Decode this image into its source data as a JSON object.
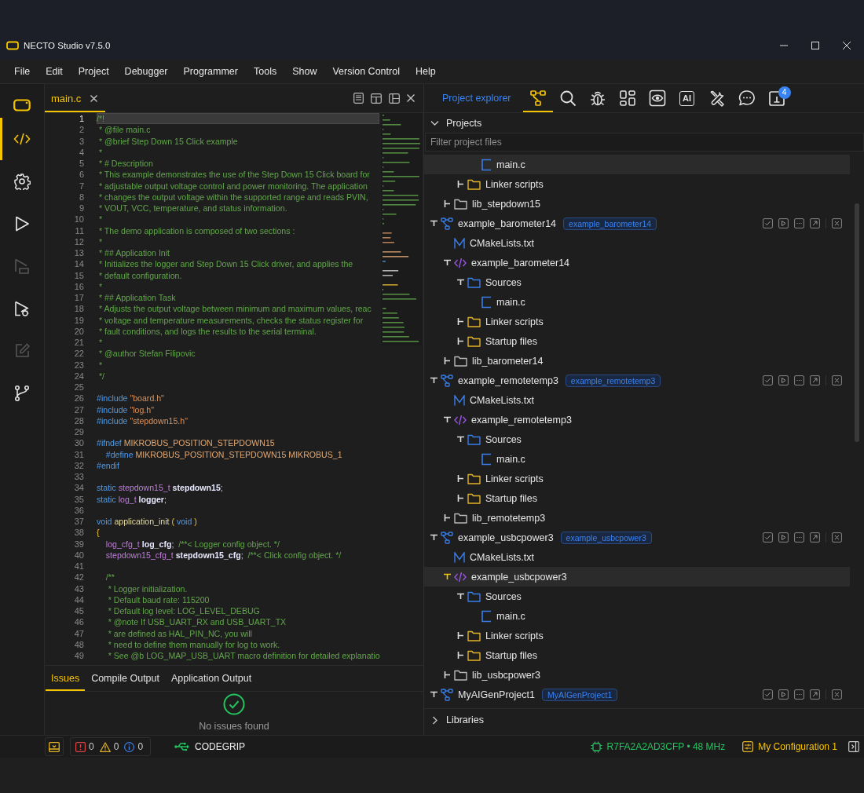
{
  "window": {
    "title": "NECTO Studio v7.5.0"
  },
  "menu": [
    {
      "label": "File"
    },
    {
      "label": "Edit"
    },
    {
      "label": "Project"
    },
    {
      "label": "Debugger"
    },
    {
      "label": "Programmer"
    },
    {
      "label": "Tools"
    },
    {
      "label": "Show"
    },
    {
      "label": "Version Control"
    },
    {
      "label": "Help"
    }
  ],
  "activity": [
    {
      "kind": "code",
      "selected": true,
      "disabled": false
    },
    {
      "kind": "settings",
      "selected": false,
      "disabled": false
    },
    {
      "kind": "run",
      "selected": false,
      "disabled": false
    },
    {
      "kind": "program",
      "selected": false,
      "disabled": true
    },
    {
      "kind": "debug",
      "selected": false,
      "disabled": false
    },
    {
      "kind": "edit",
      "selected": false,
      "disabled": true
    },
    {
      "kind": "branch",
      "selected": false,
      "disabled": false
    }
  ],
  "editor": {
    "tabs": [
      {
        "label": "main.c",
        "selected": true
      }
    ],
    "lines": [
      {
        "number": "1",
        "current": true,
        "tokens": [
          {
            "kind": "comment",
            "text": "/*!"
          }
        ]
      },
      {
        "number": "2",
        "current": false,
        "tokens": [
          {
            "kind": "comment",
            "text": " * @file main.c"
          }
        ]
      },
      {
        "number": "3",
        "current": false,
        "tokens": [
          {
            "kind": "comment",
            "text": " * @brief Step Down 15 Click example"
          }
        ]
      },
      {
        "number": "4",
        "current": false,
        "tokens": [
          {
            "kind": "comment",
            "text": " *"
          }
        ]
      },
      {
        "number": "5",
        "current": false,
        "tokens": [
          {
            "kind": "comment",
            "text": " * # Description"
          }
        ]
      },
      {
        "number": "6",
        "current": false,
        "tokens": [
          {
            "kind": "comment",
            "text": " * This example demonstrates the use of the Step Down 15 Click board for"
          }
        ]
      },
      {
        "number": "7",
        "current": false,
        "tokens": [
          {
            "kind": "comment",
            "text": " * adjustable output voltage control and power monitoring. The application"
          }
        ]
      },
      {
        "number": "8",
        "current": false,
        "tokens": [
          {
            "kind": "comment",
            "text": " * changes the output voltage within the supported range and reads PVIN,"
          }
        ]
      },
      {
        "number": "9",
        "current": false,
        "tokens": [
          {
            "kind": "comment",
            "text": " * VOUT, VCC, temperature, and status information."
          }
        ]
      },
      {
        "number": "10",
        "current": false,
        "tokens": [
          {
            "kind": "comment",
            "text": " *"
          }
        ]
      },
      {
        "number": "11",
        "current": false,
        "tokens": [
          {
            "kind": "comment",
            "text": " * The demo application is composed of two sections :"
          }
        ]
      },
      {
        "number": "12",
        "current": false,
        "tokens": [
          {
            "kind": "comment",
            "text": " *"
          }
        ]
      },
      {
        "number": "13",
        "current": false,
        "tokens": [
          {
            "kind": "comment",
            "text": " * ## Application Init"
          }
        ]
      },
      {
        "number": "14",
        "current": false,
        "tokens": [
          {
            "kind": "comment",
            "text": " * Initializes the logger and Step Down 15 Click driver, and applies the"
          }
        ]
      },
      {
        "number": "15",
        "current": false,
        "tokens": [
          {
            "kind": "comment",
            "text": " * default configuration."
          }
        ]
      },
      {
        "number": "16",
        "current": false,
        "tokens": [
          {
            "kind": "comment",
            "text": " *"
          }
        ]
      },
      {
        "number": "17",
        "current": false,
        "tokens": [
          {
            "kind": "comment",
            "text": " * ## Application Task"
          }
        ]
      },
      {
        "number": "18",
        "current": false,
        "tokens": [
          {
            "kind": "comment",
            "text": " * Adjusts the output voltage between minimum and maximum values, reac"
          }
        ]
      },
      {
        "number": "19",
        "current": false,
        "tokens": [
          {
            "kind": "comment",
            "text": " * voltage and temperature measurements, checks the status register for"
          }
        ]
      },
      {
        "number": "20",
        "current": false,
        "tokens": [
          {
            "kind": "comment",
            "text": " * fault conditions, and logs the results to the serial terminal."
          }
        ]
      },
      {
        "number": "21",
        "current": false,
        "tokens": [
          {
            "kind": "comment",
            "text": " *"
          }
        ]
      },
      {
        "number": "22",
        "current": false,
        "tokens": [
          {
            "kind": "comment",
            "text": " * @author Stefan Filipovic"
          }
        ]
      },
      {
        "number": "23",
        "current": false,
        "tokens": [
          {
            "kind": "comment",
            "text": " *"
          }
        ]
      },
      {
        "number": "24",
        "current": false,
        "tokens": [
          {
            "kind": "comment",
            "text": " */"
          }
        ]
      },
      {
        "number": "25",
        "current": false
      },
      {
        "number": "26",
        "current": false,
        "tokens": [
          {
            "kind": "keyword",
            "text": "#include"
          },
          {
            "kind": "string",
            "text": " \"board.h\""
          }
        ]
      },
      {
        "number": "27",
        "current": false,
        "tokens": [
          {
            "kind": "keyword",
            "text": "#include"
          },
          {
            "kind": "string",
            "text": " \"log.h\""
          }
        ]
      },
      {
        "number": "28",
        "current": false,
        "tokens": [
          {
            "kind": "keyword",
            "text": "#include"
          },
          {
            "kind": "string",
            "text": " \"stepdown15.h\""
          }
        ]
      },
      {
        "number": "29",
        "current": false
      },
      {
        "number": "30",
        "current": false,
        "tokens": [
          {
            "kind": "keyword",
            "text": "#ifndef"
          },
          {
            "kind": "macro",
            "text": " MIKROBUS_POSITION_STEPDOWN15"
          }
        ]
      },
      {
        "number": "31",
        "current": false,
        "tokens": [
          {
            "kind": "keyword",
            "text": "    #define"
          },
          {
            "kind": "macro",
            "text": " MIKROBUS_POSITION_STEPDOWN15 MIKROBUS_1"
          }
        ]
      },
      {
        "number": "32",
        "current": false,
        "tokens": [
          {
            "kind": "keyword",
            "text": "#endif"
          }
        ]
      },
      {
        "number": "33",
        "current": false
      },
      {
        "number": "34",
        "current": false,
        "tokens": [
          {
            "kind": "keyword",
            "text": "static"
          },
          {
            "kind": "type",
            "text": " stepdown15_t"
          },
          {
            "kind": "variable",
            "text": " stepdown15"
          },
          {
            "kind": "plain",
            "text": ";"
          }
        ]
      },
      {
        "number": "35",
        "current": false,
        "tokens": [
          {
            "kind": "keyword",
            "text": "static"
          },
          {
            "kind": "type",
            "text": " log_t"
          },
          {
            "kind": "variable",
            "text": " logger"
          },
          {
            "kind": "plain",
            "text": ";"
          }
        ]
      },
      {
        "number": "36",
        "current": false
      },
      {
        "number": "37",
        "current": false,
        "tokens": [
          {
            "kind": "keyword",
            "text": "void"
          },
          {
            "kind": "function",
            "text": " application_init"
          },
          {
            "kind": "bracket",
            "text": " ("
          },
          {
            "kind": "keyword",
            "text": " void"
          },
          {
            "kind": "bracket",
            "text": " )"
          }
        ]
      },
      {
        "number": "38",
        "current": false,
        "tokens": [
          {
            "kind": "bracket",
            "text": "{"
          }
        ]
      },
      {
        "number": "39",
        "current": false,
        "tokens": [
          {
            "kind": "type",
            "text": "    log_cfg_t"
          },
          {
            "kind": "variable",
            "text": " log_cfg"
          },
          {
            "kind": "plain",
            "text": ";"
          },
          {
            "kind": "comment",
            "text": "  /**< Logger config object. */"
          }
        ]
      },
      {
        "number": "40",
        "current": false,
        "tokens": [
          {
            "kind": "type",
            "text": "    stepdown15_cfg_t"
          },
          {
            "kind": "variable",
            "text": " stepdown15_cfg"
          },
          {
            "kind": "plain",
            "text": ";"
          },
          {
            "kind": "comment",
            "text": "  /**< Click config object. */"
          }
        ]
      },
      {
        "number": "41",
        "current": false
      },
      {
        "number": "42",
        "current": false,
        "tokens": [
          {
            "kind": "comment",
            "text": "    /**"
          }
        ]
      },
      {
        "number": "43",
        "current": false,
        "tokens": [
          {
            "kind": "comment",
            "text": "     * Logger initialization."
          }
        ]
      },
      {
        "number": "44",
        "current": false,
        "tokens": [
          {
            "kind": "comment",
            "text": "     * Default baud rate: 115200"
          }
        ]
      },
      {
        "number": "45",
        "current": false,
        "tokens": [
          {
            "kind": "comment",
            "text": "     * Default log level: LOG_LEVEL_DEBUG"
          }
        ]
      },
      {
        "number": "46",
        "current": false,
        "tokens": [
          {
            "kind": "comment",
            "text": "     * @note If USB_UART_RX and USB_UART_TX"
          }
        ]
      },
      {
        "number": "47",
        "current": false,
        "tokens": [
          {
            "kind": "comment",
            "text": "     * are defined as HAL_PIN_NC, you will"
          }
        ]
      },
      {
        "number": "48",
        "current": false,
        "tokens": [
          {
            "kind": "comment",
            "text": "     * need to define them manually for log to work."
          }
        ]
      },
      {
        "number": "49",
        "current": false,
        "tokens": [
          {
            "kind": "comment",
            "text": "     * See @b LOG_MAP_USB_UART macro definition for detailed explanatio"
          }
        ]
      }
    ]
  },
  "output_panel": {
    "tabs": [
      {
        "label": "Issues",
        "selected": true
      },
      {
        "label": "Compile Output",
        "selected": false
      },
      {
        "label": "Application Output",
        "selected": false
      }
    ],
    "message": "No issues found"
  },
  "explorer": {
    "title": "Project explorer",
    "tool_tabs": [
      {
        "kind": "projects",
        "selected": true
      },
      {
        "kind": "search",
        "selected": false
      },
      {
        "kind": "debug",
        "selected": false
      },
      {
        "kind": "widgets",
        "selected": false
      },
      {
        "kind": "view",
        "selected": false
      },
      {
        "kind": "ai",
        "text": "AI",
        "selected": false
      },
      {
        "kind": "tools",
        "selected": false
      },
      {
        "kind": "chat",
        "selected": false
      },
      {
        "kind": "inbox",
        "selected": false,
        "badge": "4"
      }
    ],
    "section": {
      "label": "Projects",
      "expanded": true
    },
    "filter": {
      "placeholder": "Filter project files"
    },
    "tree": [
      {
        "children": [
          {
            "children": [
              {
                "children": [
                  {
                    "label": "main.c",
                    "kind": "c-file",
                    "selected": true
                  }
                ]
              },
              {
                "label": "Linker scripts",
                "kind": "support-folder",
                "expanded": false,
                "selected": false
              }
            ]
          },
          {
            "label": "lib_stepdown15",
            "kind": "library-folder",
            "expanded": false,
            "selected": false
          }
        ]
      },
      {
        "label": "example_barometer14",
        "kind": "project",
        "badge": "example_barometer14",
        "expanded": true,
        "selected": false,
        "children": [
          {
            "label": "CMakeLists.txt",
            "kind": "cmake-file",
            "selected": false
          },
          {
            "label": "example_barometer14",
            "kind": "code-folder",
            "expanded": true,
            "selected": false,
            "children": [
              {
                "label": "Sources",
                "kind": "source-folder",
                "expanded": true,
                "selected": false,
                "children": [
                  {
                    "label": "main.c",
                    "kind": "c-file",
                    "selected": false
                  }
                ]
              },
              {
                "label": "Linker scripts",
                "kind": "support-folder",
                "expanded": false,
                "selected": false
              },
              {
                "label": "Startup files",
                "kind": "support-folder",
                "expanded": false,
                "selected": false
              }
            ]
          },
          {
            "label": "lib_barometer14",
            "kind": "library-folder",
            "expanded": false,
            "selected": false
          }
        ]
      },
      {
        "label": "example_remotetemp3",
        "kind": "project",
        "badge": "example_remotetemp3",
        "expanded": true,
        "selected": false,
        "children": [
          {
            "label": "CMakeLists.txt",
            "kind": "cmake-file",
            "selected": false
          },
          {
            "label": "example_remotetemp3",
            "kind": "code-folder",
            "expanded": true,
            "selected": false,
            "children": [
              {
                "label": "Sources",
                "kind": "source-folder",
                "expanded": true,
                "selected": false,
                "children": [
                  {
                    "label": "main.c",
                    "kind": "c-file",
                    "selected": false
                  }
                ]
              },
              {
                "label": "Linker scripts",
                "kind": "support-folder",
                "expanded": false,
                "selected": false
              },
              {
                "label": "Startup files",
                "kind": "support-folder",
                "expanded": false,
                "selected": false
              }
            ]
          },
          {
            "label": "lib_remotetemp3",
            "kind": "library-folder",
            "expanded": false,
            "selected": false
          }
        ]
      },
      {
        "label": "example_usbcpower3",
        "kind": "project",
        "badge": "example_usbcpower3",
        "expanded": true,
        "selected": false,
        "children": [
          {
            "label": "CMakeLists.txt",
            "kind": "cmake-file",
            "selected": false
          },
          {
            "label": "example_usbcpower3",
            "kind": "code-folder",
            "expanded": true,
            "selected": true,
            "children": [
              {
                "label": "Sources",
                "kind": "source-folder",
                "expanded": true,
                "selected": false,
                "children": [
                  {
                    "label": "main.c",
                    "kind": "c-file",
                    "selected": false
                  }
                ]
              },
              {
                "label": "Linker scripts",
                "kind": "support-folder",
                "expanded": false,
                "selected": false
              },
              {
                "label": "Startup files",
                "kind": "support-folder",
                "expanded": false,
                "selected": false
              }
            ]
          },
          {
            "label": "lib_usbcpower3",
            "kind": "library-folder",
            "expanded": false,
            "selected": false
          }
        ]
      },
      {
        "label": "MyAIGenProject1",
        "kind": "project",
        "badge": "MyAIGenProject1",
        "expanded": true,
        "selected": false
      }
    ],
    "libraries": {
      "label": "Libraries",
      "expanded": false
    }
  },
  "status_bar": {
    "problems": [
      {
        "kind": "error",
        "count": "0"
      },
      {
        "kind": "warning",
        "count": "0"
      },
      {
        "kind": "info",
        "count": "0"
      }
    ],
    "programmer": "CODEGRIP",
    "device": "R7FA2A2AD3CFP • 48 MHz",
    "configuration": "My Configuration 1"
  }
}
